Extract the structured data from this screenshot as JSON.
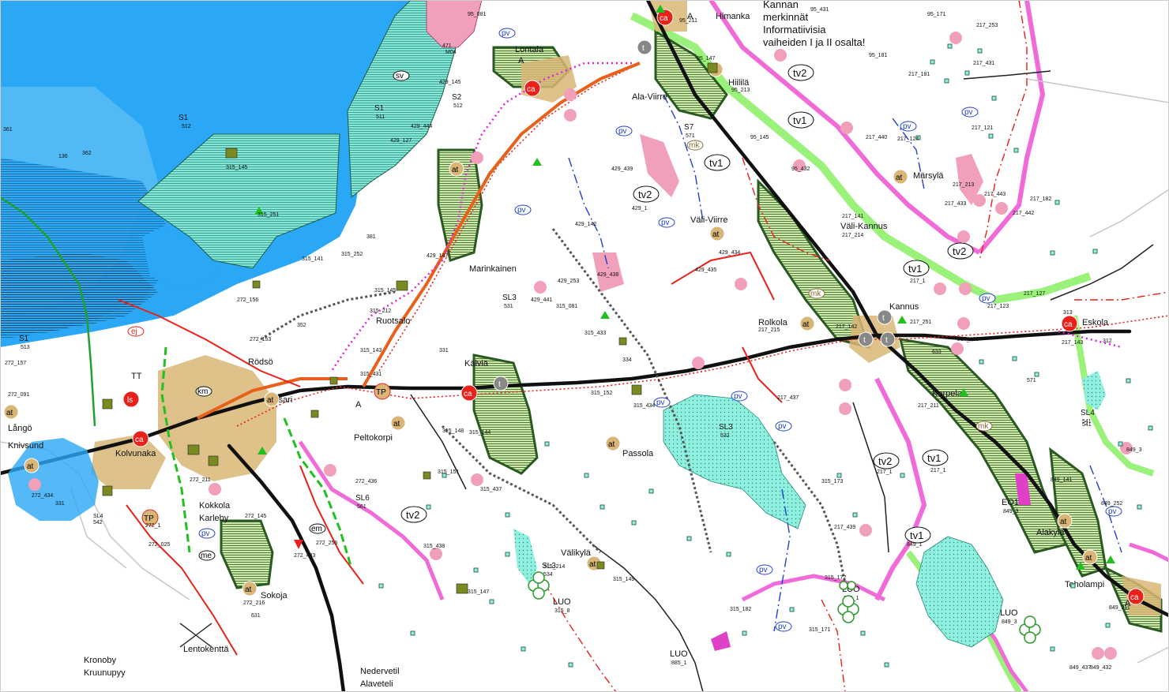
{
  "map": {
    "legend_title_lines": [
      "Kannan",
      "merkinnät",
      "Informatiivisia",
      "vaiheiden I ja II osalta!"
    ],
    "colors": {
      "sea": "#2aa7f5",
      "sea_light": "#7fd0f7",
      "mire_cyan": "#7fe8d8",
      "protected_green": "#2a7a22",
      "road_red": "#e8211a",
      "main_road": "#101010",
      "railway": "#e8211a",
      "pink_zone": "#f06ad8",
      "light_green_zone": "#9af27a",
      "settlement_tan": "#d9b676",
      "heritage_pink": "#f0a0b8"
    },
    "place_names": [
      {
        "id": "himanka",
        "text": "Himanka"
      },
      {
        "id": "lontala",
        "text": "Lontala"
      },
      {
        "id": "ala-viirre",
        "text": "Ala-Viirre"
      },
      {
        "id": "marinkainen",
        "text": "Marinkainen"
      },
      {
        "id": "kannus",
        "text": "Kannus"
      },
      {
        "id": "kalvia",
        "text": "Kälviä"
      },
      {
        "id": "ruotsalo",
        "text": "Ruotsalo"
      },
      {
        "id": "rodsby",
        "text": "Rödsö"
      },
      {
        "id": "kokkola",
        "text": "Kokkola"
      },
      {
        "id": "karleby",
        "text": "Karleby"
      },
      {
        "id": "kronoby",
        "text": "Kronoby"
      },
      {
        "id": "kruunupyy",
        "text": "Kruunupyy"
      },
      {
        "id": "toholampi",
        "text": "Toholampi"
      },
      {
        "id": "eskola",
        "text": "Eskola"
      },
      {
        "id": "korpela",
        "text": "Korpela"
      },
      {
        "id": "alakyla",
        "text": "Alakylä"
      },
      {
        "id": "marsyla",
        "text": "Märsylä"
      },
      {
        "id": "valikyla",
        "text": "Välikylä"
      },
      {
        "id": "passola",
        "text": "Passola"
      },
      {
        "id": "peltokorpi",
        "text": "Peltokorpi"
      },
      {
        "id": "kolvunkaa",
        "text": "Kolvunaka"
      },
      {
        "id": "langa",
        "text": "Långö"
      },
      {
        "id": "knivsund",
        "text": "Knivsund"
      },
      {
        "id": "vitsari",
        "text": "Vitsari"
      },
      {
        "id": "sokoja",
        "text": "Sokoja"
      },
      {
        "id": "rolkola",
        "text": "Rolkola"
      },
      {
        "id": "vali-viirre",
        "text": "Väli-Viirre"
      },
      {
        "id": "vali-kannus",
        "text": "Väli-Kannus"
      },
      {
        "id": "nedervetil",
        "text": "Nedervetil"
      },
      {
        "id": "alaveteli",
        "text": "Alaveteli"
      },
      {
        "id": "lentokentta",
        "text": "Lentokenttä"
      },
      {
        "id": "hiilila",
        "text": "Hiililä"
      }
    ],
    "zone_codes": [
      {
        "id": "s1-512",
        "text": "S1",
        "sub": "512"
      },
      {
        "id": "s1-511",
        "text": "S1",
        "sub": "511"
      },
      {
        "id": "s1-513",
        "text": "S1",
        "sub": "513"
      },
      {
        "id": "s2-512",
        "text": "S2",
        "sub": "512"
      },
      {
        "id": "s7-571",
        "text": "S7",
        "sub": "571"
      },
      {
        "id": "sl3-532",
        "text": "SL3",
        "sub": "532"
      },
      {
        "id": "sl3-534",
        "text": "SL3",
        "sub": "534"
      },
      {
        "id": "sl4-541",
        "text": "SL4",
        "sub": "541"
      },
      {
        "id": "sl6-561",
        "text": "SL6",
        "sub": "561"
      },
      {
        "id": "sl3-531",
        "text": "SL3",
        "sub": "531"
      },
      {
        "id": "eo1",
        "text": "EO1",
        "sub": "849_3"
      },
      {
        "id": "luo-1",
        "text": "LUO",
        "sub": "315_8"
      },
      {
        "id": "luo-2",
        "text": "LUO",
        "sub": "315_1"
      },
      {
        "id": "luo-3",
        "text": "LUO",
        "sub": "849_3"
      },
      {
        "id": "luo-4",
        "text": "LUO",
        "sub": "885_1"
      }
    ],
    "oval_labels": [
      "tv1",
      "tv2",
      "tv1",
      "tv2",
      "tv2",
      "tv1",
      "tv2",
      "tv1",
      "tv1",
      "tv2"
    ],
    "small_oval_labels": [
      "pv",
      "sv",
      "km",
      "mk",
      "em",
      "me",
      "lv",
      "luo",
      "ej"
    ],
    "circle_labels": [
      "ca",
      "at",
      "t",
      "TP",
      "A",
      "TT",
      "ls"
    ]
  }
}
